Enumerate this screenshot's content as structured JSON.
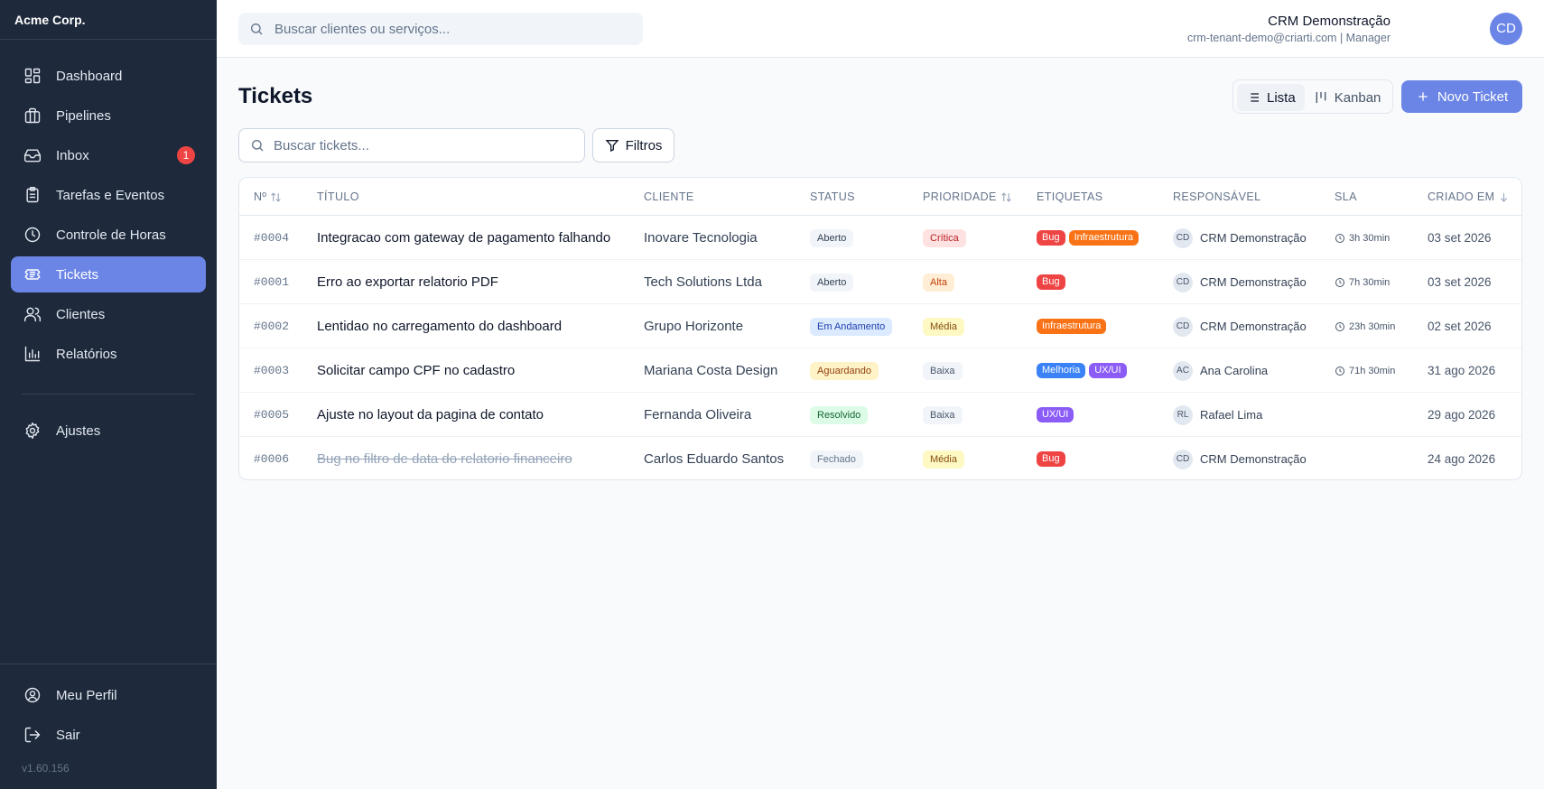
{
  "brand": "Acme Corp.",
  "sidebar": {
    "items": [
      {
        "label": "Dashboard",
        "icon": "dashboard-icon"
      },
      {
        "label": "Pipelines",
        "icon": "briefcase-icon"
      },
      {
        "label": "Inbox",
        "icon": "inbox-icon",
        "badge": "1"
      },
      {
        "label": "Tarefas e Eventos",
        "icon": "clipboard-icon"
      },
      {
        "label": "Controle de Horas",
        "icon": "clock-icon"
      },
      {
        "label": "Tickets",
        "icon": "ticket-icon",
        "active": true
      },
      {
        "label": "Clientes",
        "icon": "users-icon"
      },
      {
        "label": "Relatórios",
        "icon": "bar-chart-icon"
      }
    ],
    "settings": {
      "label": "Ajustes",
      "icon": "gear-icon"
    },
    "bottom": [
      {
        "label": "Meu Perfil",
        "icon": "user-circle-icon"
      },
      {
        "label": "Sair",
        "icon": "logout-icon"
      }
    ],
    "version": "v1.60.156"
  },
  "topbar": {
    "search_placeholder": "Buscar clientes ou serviços...",
    "user_name": "CRM Demonstração",
    "user_sub": "crm-tenant-demo@criarti.com | Manager",
    "avatar_initials": "CD"
  },
  "page": {
    "title": "Tickets",
    "view_list": "Lista",
    "view_kanban": "Kanban",
    "new_ticket": "Novo Ticket",
    "search_placeholder": "Buscar tickets...",
    "filters": "Filtros"
  },
  "table": {
    "headers": {
      "num": "Nº",
      "title": "TÍTULO",
      "client": "CLIENTE",
      "status": "STATUS",
      "priority": "PRIORIDADE",
      "tags": "ETIQUETAS",
      "owner": "RESPONSÁVEL",
      "sla": "SLA",
      "created": "CRIADO EM"
    },
    "rows": [
      {
        "num": "#0004",
        "title": "Integracao com gateway de pagamento falhando",
        "client": "Inovare Tecnologia",
        "status": "Aberto",
        "priority": "Crítica",
        "tags": [
          "Bug",
          "Infraestrutura"
        ],
        "owner_initials": "CD",
        "owner": "CRM Demonstração",
        "sla": "3h 30min",
        "created": "03 set 2026"
      },
      {
        "num": "#0001",
        "title": "Erro ao exportar relatorio PDF",
        "client": "Tech Solutions Ltda",
        "status": "Aberto",
        "priority": "Alta",
        "tags": [
          "Bug"
        ],
        "owner_initials": "CD",
        "owner": "CRM Demonstração",
        "sla": "7h 30min",
        "created": "03 set 2026"
      },
      {
        "num": "#0002",
        "title": "Lentidao no carregamento do dashboard",
        "client": "Grupo Horizonte",
        "status": "Em Andamento",
        "priority": "Média",
        "tags": [
          "Infraestrutura"
        ],
        "owner_initials": "CD",
        "owner": "CRM Demonstração",
        "sla": "23h 30min",
        "created": "02 set 2026"
      },
      {
        "num": "#0003",
        "title": "Solicitar campo CPF no cadastro",
        "client": "Mariana Costa Design",
        "status": "Aguardando",
        "priority": "Baixa",
        "tags": [
          "Melhoria",
          "UX/UI"
        ],
        "owner_initials": "AC",
        "owner": "Ana Carolina",
        "sla": "71h 30min",
        "created": "31 ago 2026"
      },
      {
        "num": "#0005",
        "title": "Ajuste no layout da pagina de contato",
        "client": "Fernanda Oliveira",
        "status": "Resolvido",
        "priority": "Baixa",
        "tags": [
          "UX/UI"
        ],
        "owner_initials": "RL",
        "owner": "Rafael Lima",
        "sla": "",
        "created": "29 ago 2026"
      },
      {
        "num": "#0006",
        "title": "Bug no filtro de data do relatorio financeiro",
        "client": "Carlos Eduardo Santos",
        "status": "Fechado",
        "priority": "Média",
        "tags": [
          "Bug"
        ],
        "owner_initials": "CD",
        "owner": "CRM Demonstração",
        "sla": "",
        "created": "24 ago 2026",
        "strike": true
      }
    ]
  },
  "colors": {
    "accent": "#6b85e6",
    "sidebar_bg": "#1e293b",
    "status": {
      "Aberto": {
        "bg": "#f1f5f9",
        "fg": "#334155"
      },
      "Em Andamento": {
        "bg": "#dbeafe",
        "fg": "#1e40af"
      },
      "Aguardando": {
        "bg": "#fef3c7",
        "fg": "#92400e"
      },
      "Resolvido": {
        "bg": "#dcfce7",
        "fg": "#166534"
      },
      "Fechado": {
        "bg": "#f1f5f9",
        "fg": "#64748b"
      }
    },
    "priority": {
      "Crítica": {
        "bg": "#fee2e2",
        "fg": "#b91c1c"
      },
      "Alta": {
        "bg": "#ffedd5",
        "fg": "#c2410c"
      },
      "Média": {
        "bg": "#fef9c3",
        "fg": "#854d0e"
      },
      "Baixa": {
        "bg": "#f1f5f9",
        "fg": "#475569"
      }
    },
    "tags": {
      "Bug": "#ef4444",
      "Infraestrutura": "#f97316",
      "Melhoria": "#3b82f6",
      "UX/UI": "#8b5cf6"
    }
  }
}
